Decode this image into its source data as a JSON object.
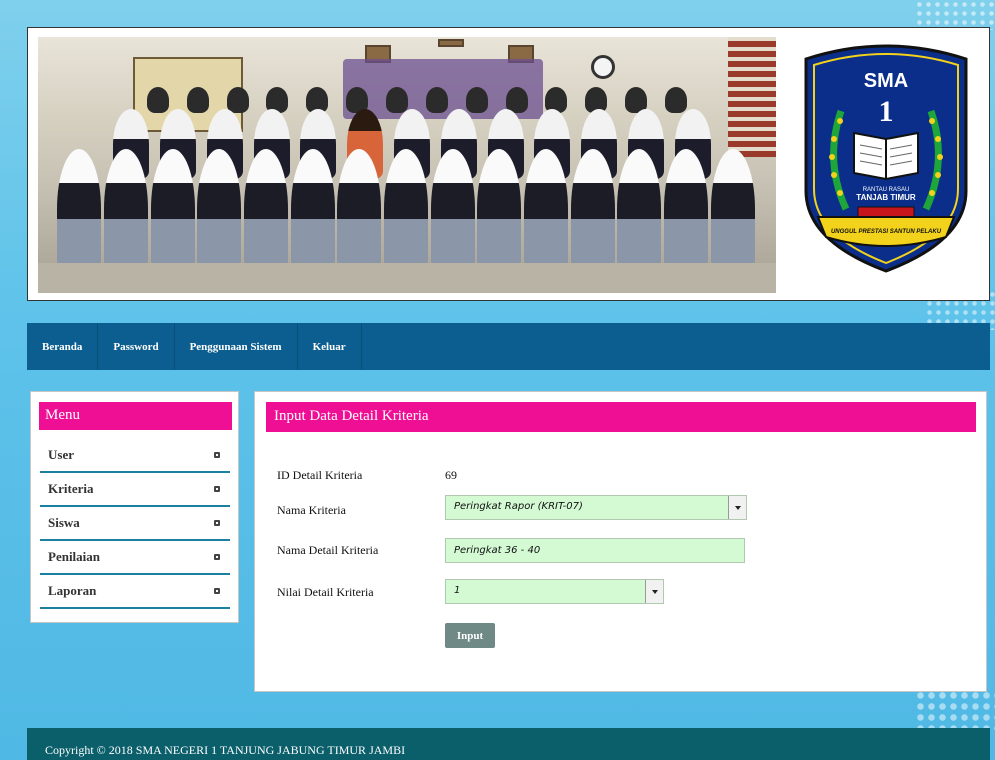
{
  "header": {
    "logo": {
      "top_text": "SMA",
      "number": "1",
      "line1": "RANTAU RASAU",
      "line2": "TANJAB TIMUR",
      "motto": "UNGGUL PRESTASI SANTUN PELAKU"
    }
  },
  "nav": {
    "items": [
      {
        "label": "Beranda"
      },
      {
        "label": "Password"
      },
      {
        "label": "Penggunaan Sistem"
      },
      {
        "label": "Keluar"
      }
    ]
  },
  "sidebar": {
    "title": "Menu",
    "items": [
      {
        "label": "User"
      },
      {
        "label": "Kriteria"
      },
      {
        "label": "Siswa"
      },
      {
        "label": "Penilaian"
      },
      {
        "label": "Laporan"
      }
    ]
  },
  "content": {
    "title": "Input Data Detail Kriteria",
    "fields": {
      "id": {
        "label": "ID Detail Kriteria",
        "value": "69"
      },
      "nama_kriteria": {
        "label": "Nama Kriteria",
        "value": "Peringkat Rapor (KRIT-07)"
      },
      "nama_detail": {
        "label": "Nama Detail Kriteria",
        "value": "Peringkat 36 - 40"
      },
      "nilai_detail": {
        "label": "Nilai Detail Kriteria",
        "value": "1"
      }
    },
    "submit_label": "Input"
  },
  "footer": {
    "text": "Copyright © 2018 SMA NEGERI 1 TANJUNG JABUNG TIMUR JAMBI"
  },
  "colors": {
    "nav_bg": "#0b5e8f",
    "accent_pink": "#ef0f95",
    "input_bg": "#d4fad4",
    "footer_bg": "#0a5f6b",
    "button_bg": "#6f8a86"
  }
}
